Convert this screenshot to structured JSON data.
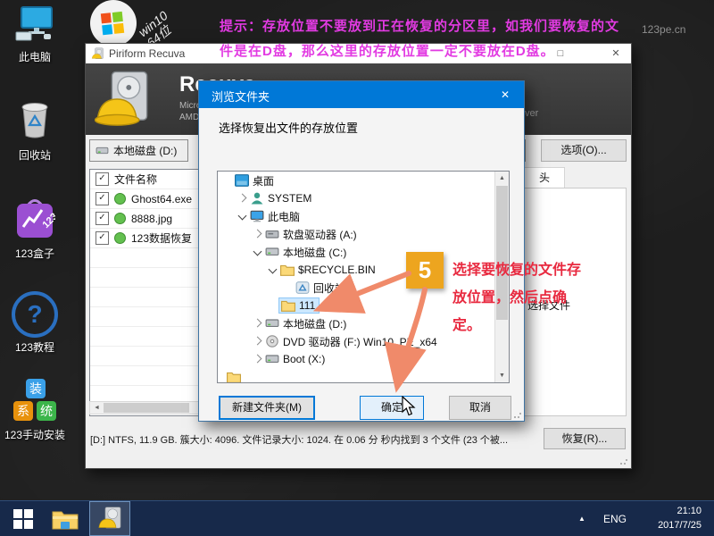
{
  "annotations": {
    "tip_line1": "提示：存放位置不要放到正在恢复的分区里，如我们要恢复的文",
    "tip_line2": "件是在D盘，那么这里的存放位置一定不要放在D盘。",
    "watermark": "123pe.cn",
    "step_badge": "5",
    "note_line1": "选择要恢复的文件存",
    "note_line2": "放位置，然后点确",
    "note_line3": "定。",
    "tip_color": "#e23ae2",
    "note_color": "#e8293f",
    "badge_color": "#eda51f",
    "arrow_color": "#f08a6a"
  },
  "desktop_icons": [
    {
      "label": "此电脑"
    },
    {
      "label": "回收站"
    },
    {
      "label": "123盒子",
      "icon_text": "123"
    },
    {
      "label": "123教程",
      "icon_text": "?"
    },
    {
      "label": "123手动安装",
      "squares": [
        "装",
        "系",
        "统"
      ]
    }
  ],
  "win10_shortcut": {
    "line1": "win10",
    "line2": "64位"
  },
  "recuva": {
    "titlebar": {
      "title": "Piriform Recuva"
    },
    "header": {
      "app_name": "Recuva",
      "info_line1": "Microsof",
      "info_line2": "AMD A8-",
      "right_fragment": "ver"
    },
    "toolbar": {
      "drive_selector": "本地磁盘 (D:)",
      "options_button": "选项(O)..."
    },
    "tab_header": "头",
    "file_list": {
      "header": "文件名称",
      "rows": [
        {
          "name": "Ghost64.exe",
          "state": "recoverable"
        },
        {
          "name": "8888.jpg",
          "state": "recoverable"
        },
        {
          "name": "123数据恢复",
          "state": "recoverable"
        }
      ]
    },
    "preview_fragment": "选择文件",
    "status": "[D:] NTFS, 11.9 GB. 簇大小: 4096. 文件记录大小: 1024. 在 0.06 分 秒内找到 3 个文件 (23 个被...",
    "recover_button": "恢复(R)..."
  },
  "dialog": {
    "title": "浏览文件夹",
    "prompt": "选择恢复出文件的存放位置",
    "tree": [
      {
        "label": "桌面",
        "expander": "none"
      },
      {
        "label": "SYSTEM",
        "expander": "closed"
      },
      {
        "label": "此电脑",
        "expander": "open"
      },
      {
        "label": "软盘驱动器 (A:)",
        "expander": "closed"
      },
      {
        "label": "本地磁盘 (C:)",
        "expander": "open"
      },
      {
        "label": "$RECYCLE.BIN",
        "expander": "open"
      },
      {
        "label": "回收站",
        "expander": "none"
      },
      {
        "label": "111",
        "expander": "none",
        "selected": true
      },
      {
        "label": "本地磁盘 (D:)",
        "expander": "closed"
      },
      {
        "label": "DVD 驱动器 (F:) Win10_PE_x64",
        "expander": "closed"
      },
      {
        "label": "Boot (X:)",
        "expander": "closed"
      }
    ],
    "buttons": {
      "new_folder": "新建文件夹(M)",
      "ok": "确定",
      "cancel": "取消"
    }
  },
  "taskbar": {
    "language": "ENG",
    "time": "21:10",
    "date": "2017/7/25"
  },
  "icons": {
    "check": "✓",
    "maximize": "□",
    "close": "✕",
    "scroll_up": "▲",
    "scroll_down": "▼",
    "scroll_left": "◄",
    "tray_up": "▲",
    "dropdown": "▼"
  }
}
